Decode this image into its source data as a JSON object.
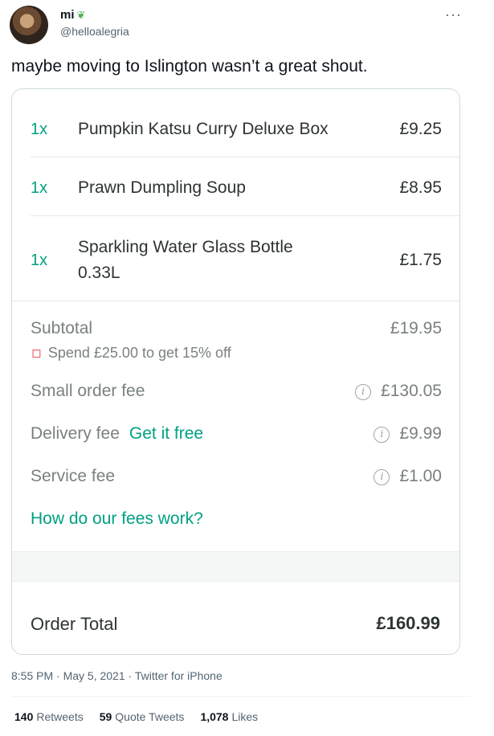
{
  "tweet": {
    "display_name": "mi",
    "name_emoji": "herb-icon",
    "handle": "@helloalegria",
    "text": "maybe moving to Islington wasn’t a great shout.",
    "meta": "8:55 PM · May 5, 2021 · Twitter for iPhone",
    "stats": {
      "retweets_count": "140",
      "retweets_label": "Retweets",
      "quotes_count": "59",
      "quotes_label": "Quote Tweets",
      "likes_count": "1,078",
      "likes_label": "Likes"
    }
  },
  "receipt": {
    "items": [
      {
        "qty": "1x",
        "name": "Pumpkin Katsu Curry Deluxe Box",
        "price": "£9.25"
      },
      {
        "qty": "1x",
        "name": "Prawn Dumpling Soup",
        "price": "£8.95"
      },
      {
        "qty": "1x",
        "name_line1": "Sparkling Water Glass Bottle",
        "name_line2": "0.33L",
        "price": "£1.75"
      }
    ],
    "subtotal": {
      "label": "Subtotal",
      "value": "£19.95"
    },
    "promo": "Spend £25.00 to get 15% off",
    "small_order_fee": {
      "label": "Small order fee",
      "value": "£130.05"
    },
    "delivery_fee": {
      "label": "Delivery fee",
      "link": "Get it free",
      "value": "£9.99"
    },
    "service_fee": {
      "label": "Service fee",
      "value": "£1.00"
    },
    "fees_link": "How do our fees work?",
    "order_total": {
      "label": "Order Total",
      "value": "£160.99"
    }
  },
  "colors": {
    "accent": "#00a082",
    "promo_tag": "#e8404a",
    "muted": "#7a8080"
  }
}
